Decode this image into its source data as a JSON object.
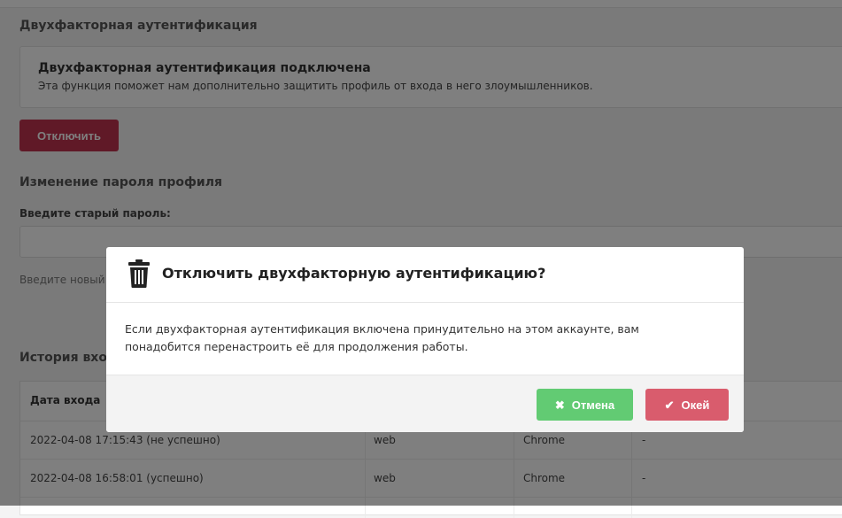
{
  "twofa": {
    "section_title": "Двухфакторная аутентификация",
    "status_title": "Двухфакторная аутентификация подключена",
    "status_desc": "Эта функция поможет нам дополнительно защитить профиль от входа в него злоумышленников.",
    "disable_label": "Отключить"
  },
  "password": {
    "section_title": "Изменение пароля профиля",
    "old_label": "Введите старый пароль:",
    "new_label": "Введите новый"
  },
  "history": {
    "section_title": "История входо",
    "col_date": "Дата входа",
    "rows": [
      {
        "date": "2022-04-08 17:15:43 (не успешно)",
        "source": "web",
        "browser": "Chrome",
        "extra": "-"
      },
      {
        "date": "2022-04-08 16:58:01 (успешно)",
        "source": "web",
        "browser": "Chrome",
        "extra": "-"
      }
    ]
  },
  "modal": {
    "icon": "trash-icon",
    "title": "Отключить двухфакторную аутентификацию?",
    "body": "Если двухфакторная аутентификация включена принудительно на этом аккаунте, вам понадобится перенастроить её для продолжения работы.",
    "cancel_label": "Отмена",
    "cancel_icon": "close-icon",
    "ok_label": "Окей",
    "ok_icon": "check-icon"
  },
  "colors": {
    "overlay": "rgba(0,0,0,0.5)",
    "danger": "#c0334e",
    "cancel": "#62cb73",
    "ok": "#d95c6d"
  }
}
